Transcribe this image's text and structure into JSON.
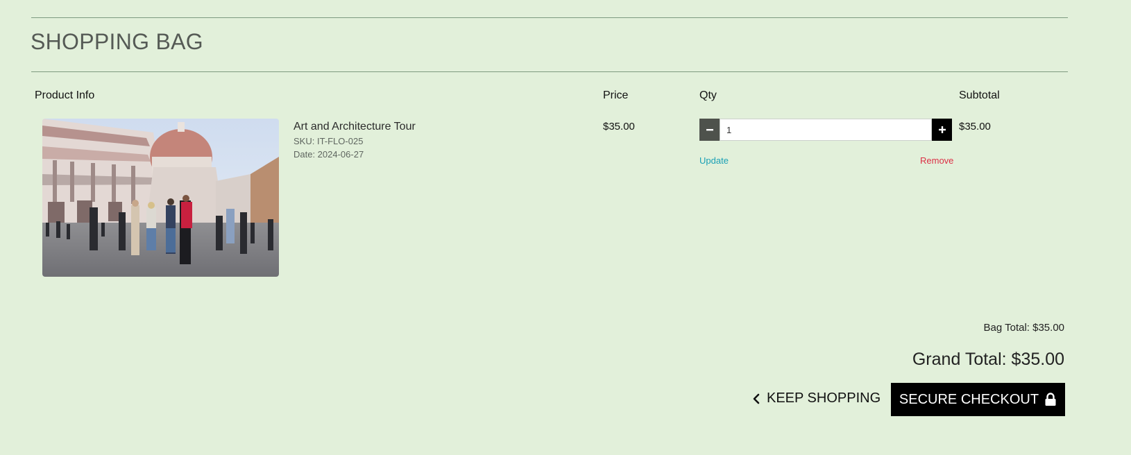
{
  "page_title": "SHOPPING BAG",
  "table": {
    "headers": {
      "product_info": "Product Info",
      "price": "Price",
      "qty": "Qty",
      "subtotal": "Subtotal"
    }
  },
  "items": [
    {
      "name": "Art and Architecture Tour",
      "sku": "SKU: IT-FLO-025",
      "date": "Date: 2024-06-27",
      "price": "$35.00",
      "qty": "1",
      "subtotal": "$35.00",
      "update_label": "Update",
      "remove_label": "Remove"
    }
  ],
  "totals": {
    "bag_total": "Bag Total: $35.00",
    "grand_total": "Grand Total: $35.00"
  },
  "actions": {
    "keep_shopping": "KEEP SHOPPING",
    "secure_checkout": "SECURE CHECKOUT"
  },
  "icons": {
    "minus": "minus-icon",
    "plus": "plus-icon",
    "chevron": "chevron-left-icon",
    "lock": "lock-icon"
  },
  "colors": {
    "background": "#e2f0da",
    "update_link": "#1aa0b5",
    "remove_link": "#dc2f45",
    "checkout_button": "#000000"
  }
}
